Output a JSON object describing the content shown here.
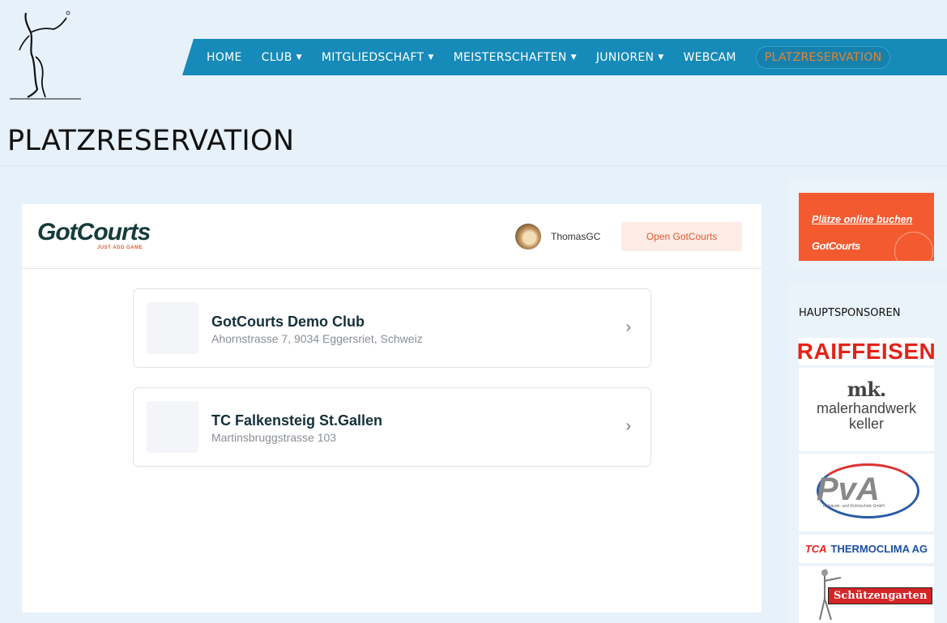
{
  "nav": {
    "items": [
      {
        "label": "HOME",
        "dropdown": false
      },
      {
        "label": "CLUB",
        "dropdown": true
      },
      {
        "label": "MITGLIEDSCHAFT",
        "dropdown": true
      },
      {
        "label": "MEISTERSCHAFTEN",
        "dropdown": true
      },
      {
        "label": "JUNIOREN",
        "dropdown": true
      },
      {
        "label": "WEBCAM",
        "dropdown": false
      },
      {
        "label": "PLATZRESERVATION",
        "dropdown": false,
        "active": true
      }
    ]
  },
  "page": {
    "title": "PLATZRESERVATION"
  },
  "gotcourts": {
    "logo_text": "GotCourts",
    "tagline": "JUST ADD GAME",
    "username": "ThomasGC",
    "open_button": "Open GotCourts",
    "clubs": [
      {
        "name": "GotCourts Demo Club",
        "address": "Ahornstrasse 7, 9034 Eggersriet, Schweiz"
      },
      {
        "name": "TC Falkensteig St.Gallen",
        "address": "Martinsbruggstrasse 103"
      }
    ]
  },
  "sidebar": {
    "promo": {
      "line1": "Plätze online buchen",
      "line2": "GotCourts"
    },
    "sponsors_title": "HAUPTSPONSOREN",
    "sponsors": {
      "raiffeisen": "RAIFFEISEN",
      "keller_logo": "mk.",
      "keller_line1": "malerhandwerk",
      "keller_line2": "keller",
      "pva": "PvA",
      "pva_sub": "Gebäude- und Rohrtechnik GmbH",
      "thermo_prefix": "TCA",
      "thermo_name": "THERMOCLIMA AG",
      "schuetzengarten": "Schützengarten"
    }
  },
  "colors": {
    "nav_bg": "#168ab8",
    "active_nav": "#e8832e",
    "accent": "#f35a2f",
    "page_bg": "#e7f1f9"
  },
  "icons": {
    "chevron": "chevron-right-icon",
    "caret": "caret-down-icon"
  }
}
